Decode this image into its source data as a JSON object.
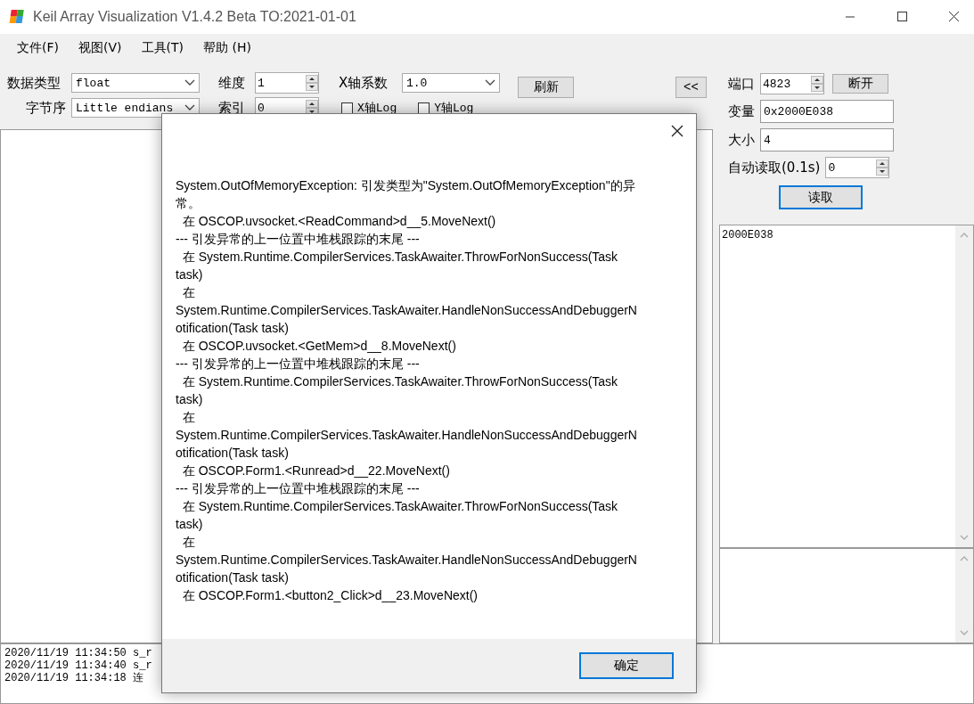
{
  "window": {
    "title": "Keil Array Visualization V1.4.2 Beta TO:2021-01-01"
  },
  "menu": [
    "文件(F)",
    "视图(V)",
    "工具(T)",
    "帮助 (H)"
  ],
  "toolbar": {
    "data_type": {
      "label": "数据类型",
      "value": "float"
    },
    "byte_order": {
      "label": "字节序",
      "value": "Little endians"
    },
    "dimension": {
      "label": "维度",
      "value": "1"
    },
    "index": {
      "label": "索引",
      "value": "0"
    },
    "x_coeff": {
      "label": "X轴系数",
      "value": "1.0"
    },
    "checkboxes": [
      {
        "label": "X轴Log",
        "checked": false
      },
      {
        "label": "Y轴Log",
        "checked": false
      }
    ],
    "refresh_button": "刷新",
    "collapse_button": "<<"
  },
  "connection": {
    "port": {
      "label": "端口",
      "value": "4823"
    },
    "disconnect_button": "断开",
    "variable": {
      "label": "变量",
      "value": "0x2000E038"
    },
    "size": {
      "label": "大小",
      "value": "4"
    },
    "auto_read": {
      "label": "自动读取(0.1s)",
      "value": "0"
    },
    "read_button": "读取"
  },
  "value_list": [
    "2000E038"
  ],
  "log": [
    "2020/11/19 11:34:50 s_r",
    "2020/11/19 11:34:40 s_r",
    "2020/11/19 11:34:18 连"
  ],
  "dialog": {
    "message": [
      "System.OutOfMemoryException: 引发类型为\"System.OutOfMemoryException\"的异",
      "常。",
      "  在 OSCOP.uvsocket.<ReadCommand>d__5.MoveNext()",
      "--- 引发异常的上一位置中堆栈跟踪的末尾 ---",
      "  在 System.Runtime.CompilerServices.TaskAwaiter.ThrowForNonSuccess(Task",
      "task)",
      "  在",
      "System.Runtime.CompilerServices.TaskAwaiter.HandleNonSuccessAndDebuggerN",
      "otification(Task task)",
      "  在 OSCOP.uvsocket.<GetMem>d__8.MoveNext()",
      "--- 引发异常的上一位置中堆栈跟踪的末尾 ---",
      "  在 System.Runtime.CompilerServices.TaskAwaiter.ThrowForNonSuccess(Task",
      "task)",
      "  在",
      "System.Runtime.CompilerServices.TaskAwaiter.HandleNonSuccessAndDebuggerN",
      "otification(Task task)",
      "  在 OSCOP.Form1.<Runread>d__22.MoveNext()",
      "--- 引发异常的上一位置中堆栈跟踪的末尾 ---",
      "  在 System.Runtime.CompilerServices.TaskAwaiter.ThrowForNonSuccess(Task",
      "task)",
      "  在",
      "System.Runtime.CompilerServices.TaskAwaiter.HandleNonSuccessAndDebuggerN",
      "otification(Task task)",
      "  在 OSCOP.Form1.<button2_Click>d__23.MoveNext()"
    ],
    "ok_button": "确定"
  }
}
